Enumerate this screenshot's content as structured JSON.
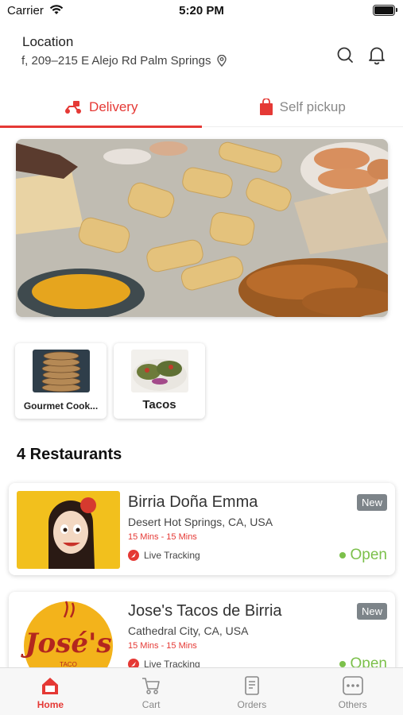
{
  "status_bar": {
    "carrier": "Carrier",
    "time": "5:20 PM"
  },
  "header": {
    "location_title": "Location",
    "location_address": "f, 209–215 E Alejo Rd Palm Springs"
  },
  "tabs": [
    {
      "label": "Delivery",
      "active": true,
      "icon": "scooter-icon"
    },
    {
      "label": "Self pickup",
      "active": false,
      "icon": "shopping-bag-icon"
    }
  ],
  "categories": [
    {
      "label": "Gourmet Cook...",
      "icon": "cookies-photo"
    },
    {
      "label": "Tacos",
      "icon": "tacos-photo"
    }
  ],
  "restaurant_count": "4 Restaurants",
  "restaurants": [
    {
      "name": "Birria Doña Emma",
      "city": "Desert Hot Springs, CA, USA",
      "eta": "15  Mins - 15  Mins",
      "tracking": "Live Tracking",
      "badge": "New",
      "status": "Open"
    },
    {
      "name": "Jose's Tacos de Birria",
      "city": "Cathedral City, CA, USA",
      "eta": "15  Mins - 15  Mins",
      "tracking": "Live Tracking",
      "badge": "New",
      "status": "Open",
      "logo_text": "José's",
      "logo_sub": "TACO"
    }
  ],
  "bottom_nav": [
    {
      "label": "Home",
      "active": true
    },
    {
      "label": "Cart",
      "active": false
    },
    {
      "label": "Orders",
      "active": false
    },
    {
      "label": "Others",
      "active": false
    }
  ],
  "colors": {
    "accent": "#e53935",
    "open": "#7cc04b",
    "badge": "#7d8489"
  }
}
